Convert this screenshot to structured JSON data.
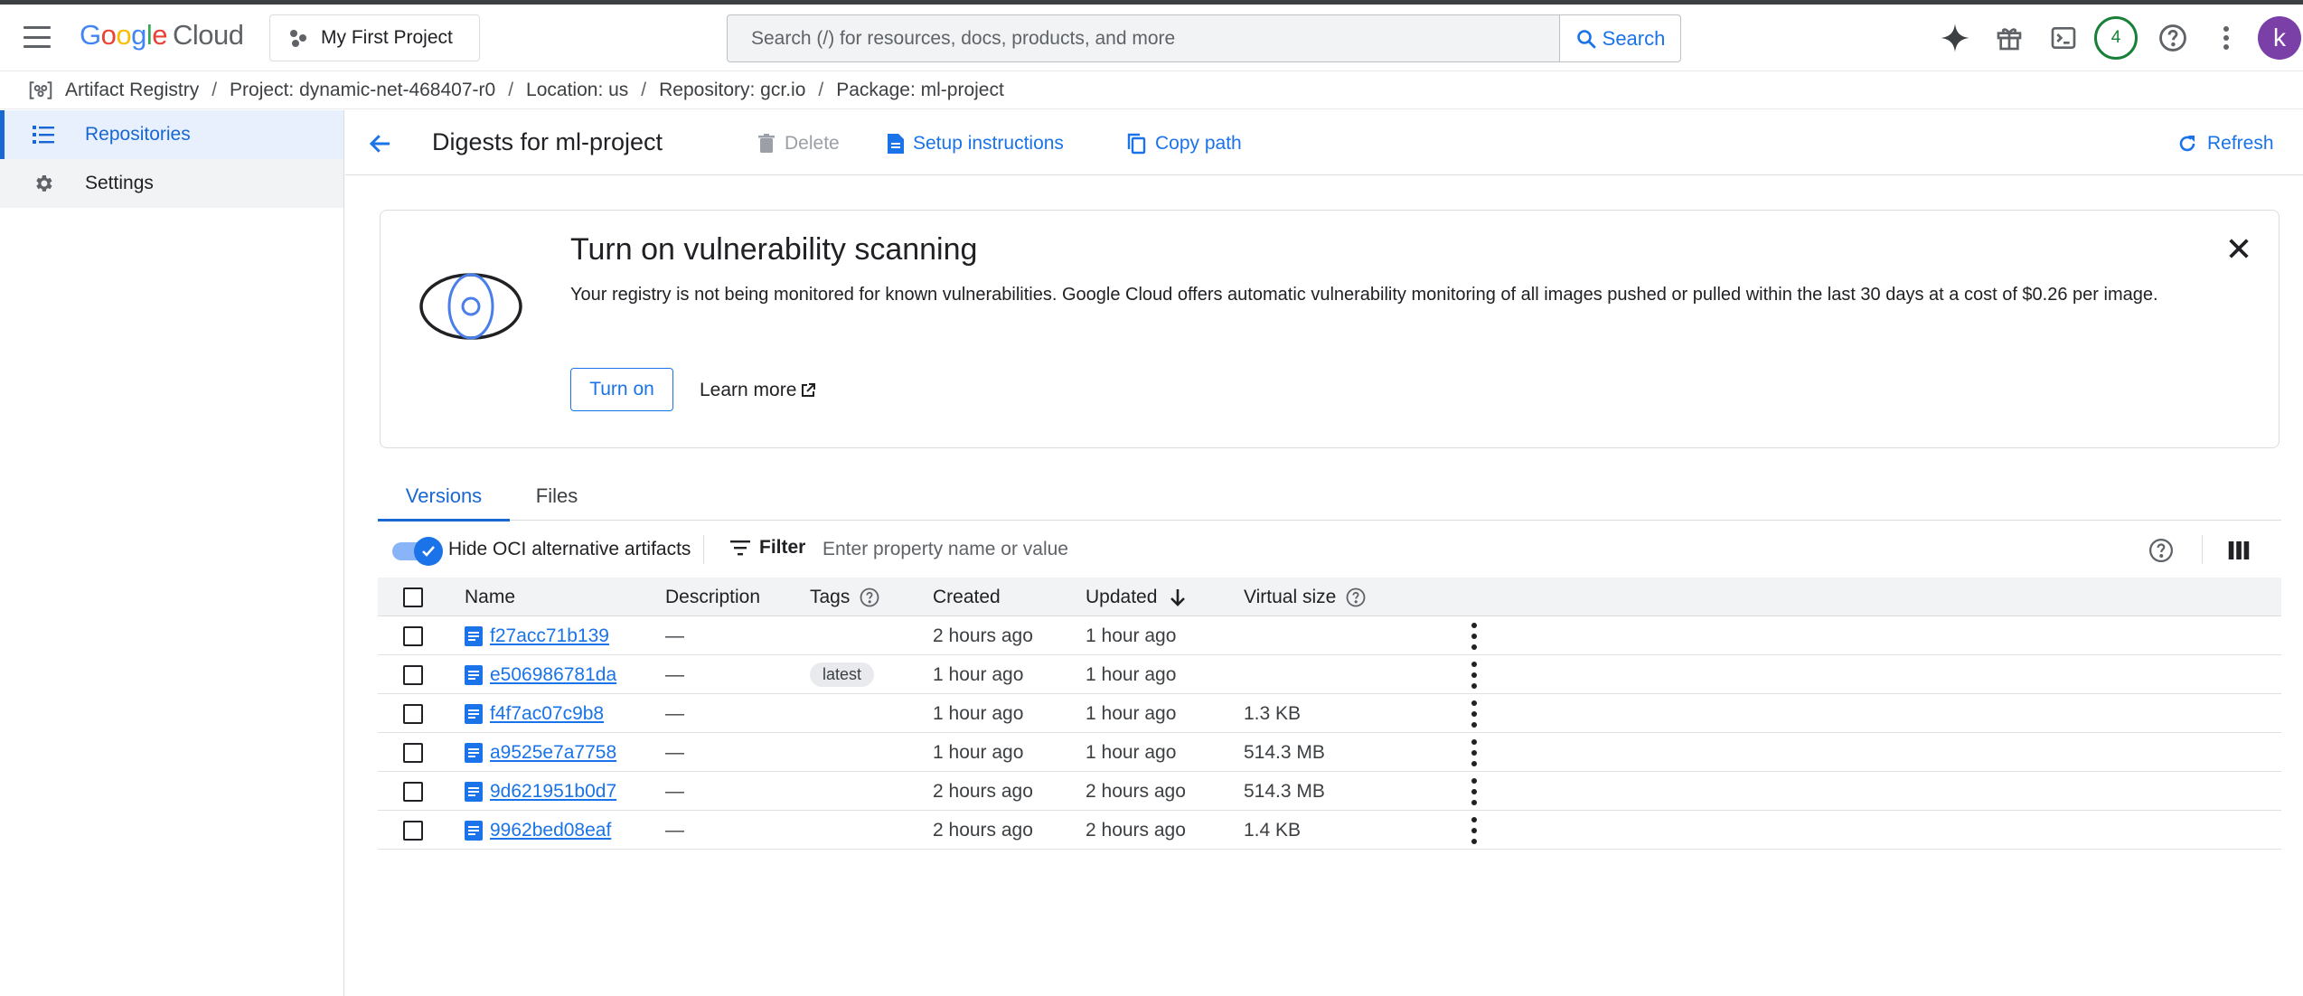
{
  "header": {
    "logo_google": "Google",
    "logo_cloud": "Cloud",
    "project_selector": "My First Project",
    "search_placeholder": "Search (/) for resources, docs, products, and more",
    "search_button": "Search",
    "notification_count": "4",
    "avatar_initial": "k"
  },
  "breadcrumb": {
    "items": [
      "Artifact Registry",
      "Project: dynamic-net-468407-r0",
      "Location: us",
      "Repository: gcr.io",
      "Package: ml-project"
    ]
  },
  "sidebar": {
    "items": [
      {
        "label": "Repositories",
        "icon": "list-icon",
        "active": true
      },
      {
        "label": "Settings",
        "icon": "gear-icon",
        "active": false
      }
    ]
  },
  "toolbar": {
    "title": "Digests for ml-project",
    "delete_label": "Delete",
    "setup_label": "Setup instructions",
    "copy_path_label": "Copy path",
    "refresh_label": "Refresh"
  },
  "banner": {
    "title": "Turn on vulnerability scanning",
    "text": "Your registry is not being monitored for known vulnerabilities. Google Cloud offers automatic vulnerability monitoring of all images pushed or pulled within the last 30 days at a cost of $0.26 per image.",
    "turn_on_label": "Turn on",
    "learn_more_label": "Learn more"
  },
  "tabs": [
    {
      "label": "Versions",
      "active": true
    },
    {
      "label": "Files",
      "active": false
    }
  ],
  "filterbar": {
    "toggle_label": "Hide OCI alternative artifacts",
    "toggle_on": true,
    "filter_label": "Filter",
    "filter_placeholder": "Enter property name or value"
  },
  "table": {
    "columns": [
      "Name",
      "Description",
      "Tags",
      "Created",
      "Updated",
      "Virtual size"
    ],
    "sort_column": "Updated",
    "sort_direction": "descending",
    "rows": [
      {
        "name": "f27acc71b139",
        "description": "—",
        "tag": "",
        "created": "2 hours ago",
        "updated": "1 hour ago",
        "size": ""
      },
      {
        "name": "e506986781da",
        "description": "—",
        "tag": "latest",
        "created": "1 hour ago",
        "updated": "1 hour ago",
        "size": ""
      },
      {
        "name": "f4f7ac07c9b8",
        "description": "—",
        "tag": "",
        "created": "1 hour ago",
        "updated": "1 hour ago",
        "size": "1.3 KB"
      },
      {
        "name": "a9525e7a7758",
        "description": "—",
        "tag": "",
        "created": "1 hour ago",
        "updated": "1 hour ago",
        "size": "514.3 MB"
      },
      {
        "name": "9d621951b0d7",
        "description": "—",
        "tag": "",
        "created": "2 hours ago",
        "updated": "2 hours ago",
        "size": "514.3 MB"
      },
      {
        "name": "9962bed08eaf",
        "description": "—",
        "tag": "",
        "created": "2 hours ago",
        "updated": "2 hours ago",
        "size": "1.4 KB"
      }
    ]
  },
  "colors": {
    "accent": "#1a73e8",
    "active_nav_bg": "#e8f0fe",
    "notification_ring": "#188038",
    "avatar_bg": "#7b3fa8"
  }
}
